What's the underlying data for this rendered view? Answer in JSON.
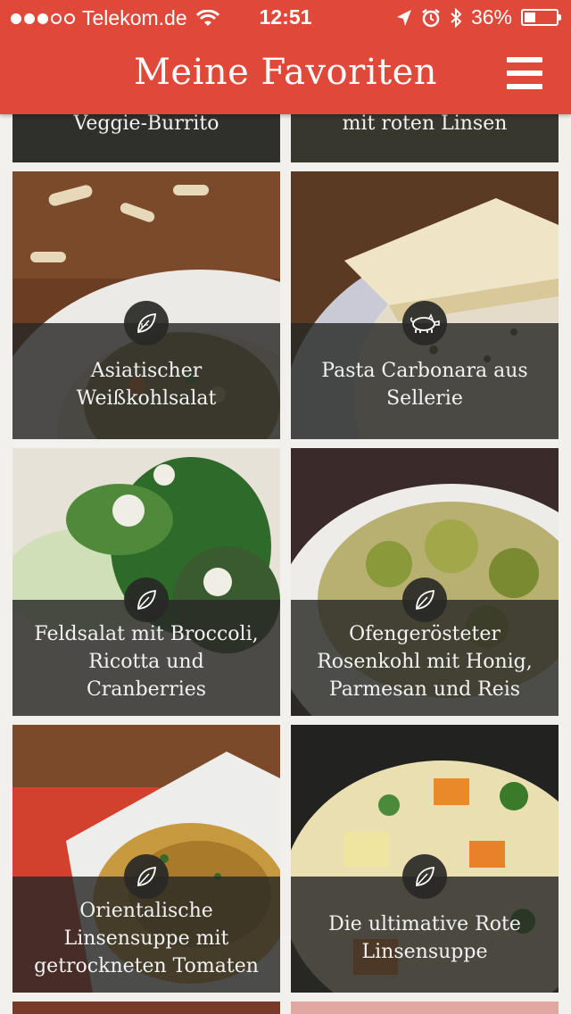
{
  "status_bar": {
    "carrier": "Telekom.de",
    "time": "12:51",
    "battery": "36%",
    "battery_level": 0.36
  },
  "header": {
    "title": "Meine Favoriten",
    "menu_icon": "hamburger-menu-icon"
  },
  "top_partial": [
    {
      "label": "Veggie-Burrito"
    },
    {
      "label": "mit roten Linsen"
    }
  ],
  "recipes": [
    {
      "label": "Asiatischer\nWeißkohlsalat",
      "icon": "leaf-icon"
    },
    {
      "label": "Pasta Carbonara aus\nSellerie",
      "icon": "pig-icon"
    },
    {
      "label": "Feldsalat mit Broccoli,\nRicotta und\nCranberries",
      "icon": "leaf-icon"
    },
    {
      "label": "Ofengerösteter\nRosenkohl mit Honig,\nParmesan und Reis",
      "icon": "leaf-icon"
    },
    {
      "label": "Orientalische\nLinsensuppe mit\ngetrockneten Tomaten",
      "icon": "leaf-icon"
    },
    {
      "label": "Die ultimative Rote\nLinsensuppe",
      "icon": "leaf-icon"
    }
  ],
  "colors": {
    "header": "#e0493a",
    "background": "#f1f0ec",
    "overlay": "#282826"
  }
}
